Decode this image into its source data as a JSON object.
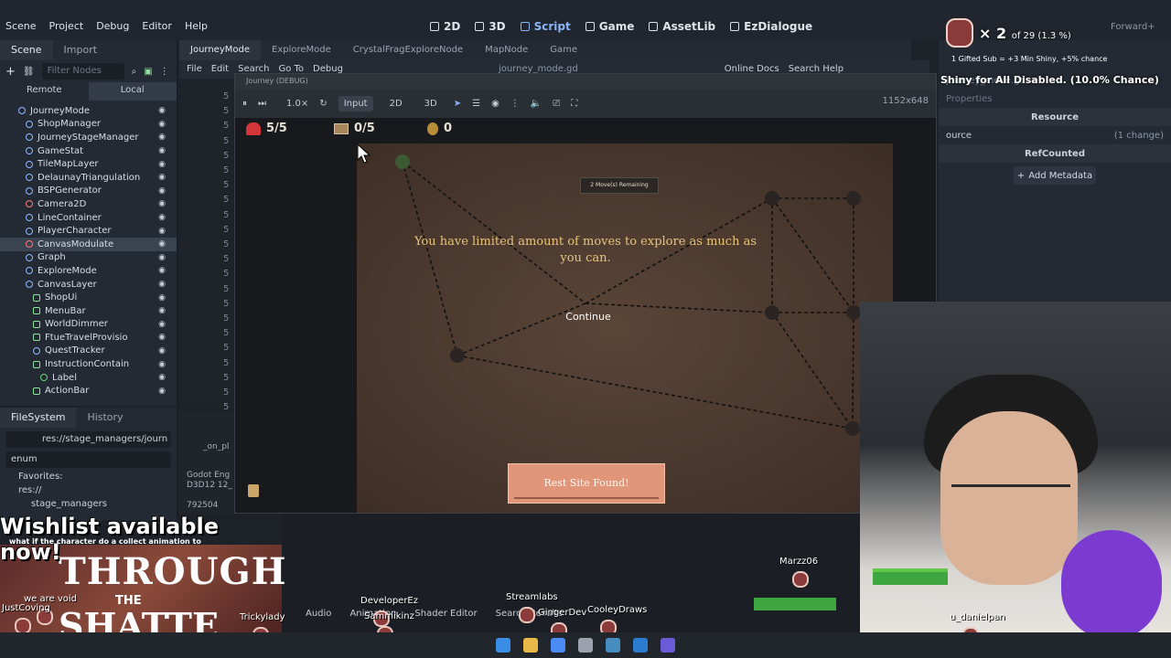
{
  "editor": {
    "menu": [
      "Scene",
      "Project",
      "Debug",
      "Editor",
      "Help"
    ],
    "workspaces": [
      {
        "label": "2D",
        "active": false
      },
      {
        "label": "3D",
        "active": false
      },
      {
        "label": "Script",
        "active": true
      },
      {
        "label": "Game",
        "active": false
      },
      {
        "label": "AssetLib",
        "active": false
      },
      {
        "label": "EzDialogue",
        "active": false
      }
    ],
    "renderer": "Forward+"
  },
  "scene_dock": {
    "tabs": [
      "Scene",
      "Import"
    ],
    "filter_placeholder": "Filter Nodes",
    "remote": "Remote",
    "local": "Local",
    "nodes": [
      {
        "label": "JourneyMode",
        "indent": 0,
        "kind": "node"
      },
      {
        "label": "ShopManager",
        "indent": 1,
        "kind": "node"
      },
      {
        "label": "JourneyStageManager",
        "indent": 1,
        "kind": "node"
      },
      {
        "label": "GameStat",
        "indent": 1,
        "kind": "node"
      },
      {
        "label": "TileMapLayer",
        "indent": 1,
        "kind": "node"
      },
      {
        "label": "DelaunayTriangulation",
        "indent": 1,
        "kind": "node"
      },
      {
        "label": "BSPGenerator",
        "indent": 1,
        "kind": "node"
      },
      {
        "label": "Camera2D",
        "indent": 1,
        "kind": "red"
      },
      {
        "label": "LineContainer",
        "indent": 1,
        "kind": "node"
      },
      {
        "label": "PlayerCharacter",
        "indent": 1,
        "kind": "node"
      },
      {
        "label": "CanvasModulate",
        "indent": 1,
        "kind": "red",
        "selected": true
      },
      {
        "label": "Graph",
        "indent": 1,
        "kind": "node"
      },
      {
        "label": "ExploreMode",
        "indent": 1,
        "kind": "node"
      },
      {
        "label": "CanvasLayer",
        "indent": 1,
        "kind": "node"
      },
      {
        "label": "ShopUi",
        "indent": 2,
        "kind": "green"
      },
      {
        "label": "MenuBar",
        "indent": 2,
        "kind": "green"
      },
      {
        "label": "WorldDimmer",
        "indent": 2,
        "kind": "green"
      },
      {
        "label": "FtueTravelProvisio",
        "indent": 2,
        "kind": "green"
      },
      {
        "label": "QuestTracker",
        "indent": 2,
        "kind": "node"
      },
      {
        "label": "InstructionContain",
        "indent": 2,
        "kind": "green"
      },
      {
        "label": "Label",
        "indent": 3,
        "kind": "grn2"
      },
      {
        "label": "ActionBar",
        "indent": 2,
        "kind": "green"
      }
    ]
  },
  "filesystem": {
    "tabs": [
      "FileSystem",
      "History"
    ],
    "path": "res://stage_managers/journ",
    "search": "enum",
    "favorites": "Favorites:",
    "items": [
      "res://",
      "stage_managers"
    ]
  },
  "script_tabs": [
    "JourneyMode",
    "ExploreMode",
    "CrystalFragExploreNode",
    "MapNode",
    "Game"
  ],
  "script_menu": [
    "File",
    "Edit",
    "Search",
    "Go To",
    "Debug"
  ],
  "script_file": "journey_mode.gd",
  "script_help": [
    "Online Docs",
    "Search Help"
  ],
  "line_numbers": [
    "5",
    "5",
    "5",
    "5",
    "5",
    "5",
    "5",
    "5",
    "5",
    "5",
    "5",
    "5",
    "5",
    "5",
    "5",
    "5",
    "5",
    "5",
    "5",
    "5",
    "5",
    "5"
  ],
  "output": {
    "line1": "_on_pl",
    "line2": "Godot Eng",
    "line3": "D3D12 12_",
    "line4": "792504"
  },
  "game_window": {
    "title": "Journey (DEBUG)",
    "zoom": "1.0×",
    "input": "Input",
    "mode2d": "2D",
    "mode3d": "3D",
    "resolution": "1152x648",
    "hud": {
      "health": "5/5",
      "chests": "0/5",
      "coins": "0"
    },
    "moves_badge": "2 Move(s) Remaining",
    "message": "You have limited amount of moves to explore as much as you can.",
    "continue": "Continue",
    "rest_button": "Rest Site Found!"
  },
  "inspector": {
    "resource": "Resource",
    "source": "ource",
    "change": "(1 change)",
    "refcounted": "RefCounted",
    "add_metadata": "Add Metadata",
    "file": "journey_mode.gd",
    "filter": "Properties"
  },
  "stream": {
    "gift_count": "2",
    "gift_of": "of 29 (1.3 %)",
    "sub_line": "1 Gifted Sub = +3 Min Shiny, +5% chance",
    "shiny": "Shiny for All Disabled. (10.0% Chance)",
    "wishlist": "Wishlist available now!",
    "wishlist_sub": "what if the character do a collect animation to",
    "title1": "THROUGH",
    "title2": "THE",
    "title3": "SHATTE",
    "bottom_tabs": [
      "Audio",
      "Animation",
      "Shader Editor",
      "Search Results"
    ],
    "names": [
      {
        "name": "Marzz06"
      },
      {
        "name": "DeveloperEz"
      },
      {
        "name": "Streamlabs"
      },
      {
        "name": "GingerDev"
      },
      {
        "name": "CooleyDraws"
      },
      {
        "name": "Sammikinz"
      },
      {
        "name": "we are void"
      },
      {
        "name": "JustCoving"
      },
      {
        "name": "Trickylady"
      },
      {
        "name": "u_danielpan"
      }
    ]
  }
}
